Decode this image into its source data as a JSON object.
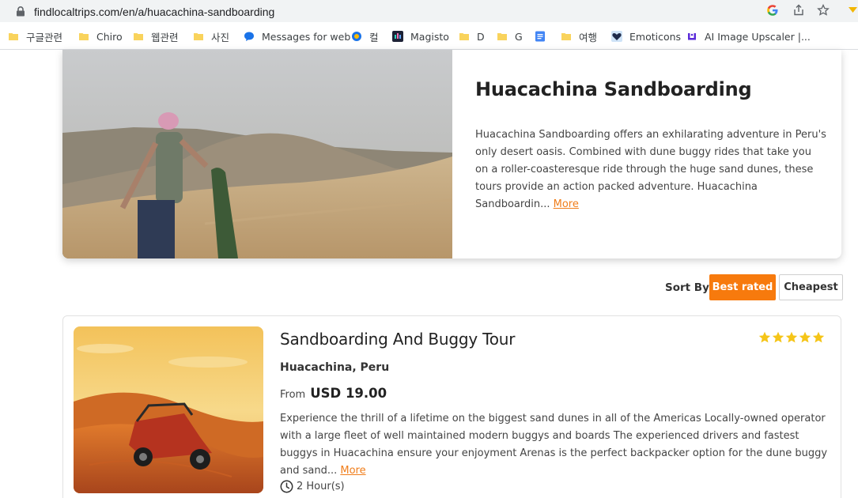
{
  "browser": {
    "url": "findlocaltrips.com/en/a/huacachina-sandboarding",
    "bookmarks": [
      {
        "label": "구글관련",
        "icon": "folder-icon"
      },
      {
        "label": "Chiro",
        "icon": "folder-icon"
      },
      {
        "label": "웹관련",
        "icon": "folder-icon"
      },
      {
        "label": "사진",
        "icon": "folder-icon"
      },
      {
        "label": "Messages for web",
        "icon": "messages-icon"
      },
      {
        "label": "컬",
        "icon": "circle-app-icon"
      },
      {
        "label": "Magisto",
        "icon": "magisto-icon"
      },
      {
        "label": "D",
        "icon": "folder-icon"
      },
      {
        "label": "G",
        "icon": "folder-icon"
      },
      {
        "label": "",
        "icon": "docs-icon"
      },
      {
        "label": "여행",
        "icon": "folder-icon"
      },
      {
        "label": "Emoticons",
        "icon": "heart-icon"
      },
      {
        "label": "AI Image Upscaler |...",
        "icon": "upscaler-icon"
      }
    ]
  },
  "hero": {
    "title": "Huacachina Sandboarding",
    "description": "Huacachina Sandboarding offers an exhilarating adventure in Peru's only desert oasis. Combined with dune buggy rides that take you on a roller-coasteresque ride through the huge sand dunes, these tours provide an action packed adventure. Huacachina Sandboardin...",
    "more_label": "More"
  },
  "sort": {
    "label": "Sort By:",
    "options": [
      "Best rated",
      "Cheapest"
    ],
    "selected": "Best rated"
  },
  "tours": [
    {
      "title": "Sandboarding And Buggy Tour",
      "rating": 5,
      "rating_max": 5,
      "location": "Huacachina, Peru",
      "price_prefix": "From",
      "price": "USD 19.00",
      "description": "Experience the thrill of a lifetime on the biggest sand dunes in all of the Americas Locally-owned operator with a large fleet of well maintained modern buggys and boards The experienced drivers and fastest buggys in Huacachina ensure your enjoyment Arenas is the perfect backpacker option for the dune buggy and sand...",
      "more_label": "More",
      "duration": "2 Hour(s)"
    }
  ],
  "colors": {
    "accent": "#f77a0d",
    "link": "#f07d1a",
    "star": "#f5c518"
  }
}
